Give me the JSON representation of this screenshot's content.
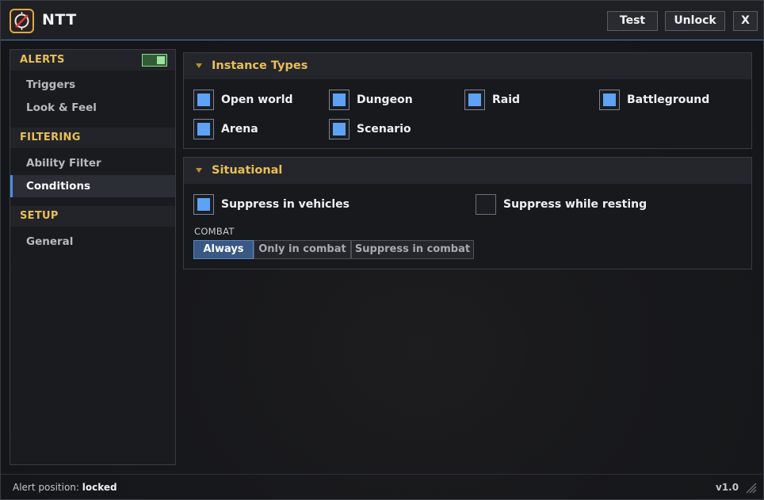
{
  "app": {
    "title": "NTT",
    "version": "v1.0",
    "colors": {
      "accent": "#5ea2f5",
      "section_header": "#e7bf57",
      "title_border": "#4e7fb8",
      "toggle_on": "#9de39e"
    }
  },
  "titlebar": {
    "logo_icon": "crossed-circle-logo",
    "buttons": {
      "test": "Test",
      "unlock": "Unlock",
      "close": "X"
    }
  },
  "sidebar": {
    "sections": [
      {
        "title": "ALERTS",
        "toggle_on": true,
        "items": [
          {
            "label": "Triggers",
            "active": false
          },
          {
            "label": "Look & Feel",
            "active": false
          }
        ]
      },
      {
        "title": "FILTERING",
        "items": [
          {
            "label": "Ability Filter",
            "active": false
          },
          {
            "label": "Conditions",
            "active": true
          }
        ]
      },
      {
        "title": "SETUP",
        "items": [
          {
            "label": "General",
            "active": false
          }
        ]
      }
    ]
  },
  "instance_types": {
    "title": "Instance Types",
    "options": [
      {
        "label": "Open world",
        "checked": true
      },
      {
        "label": "Dungeon",
        "checked": true
      },
      {
        "label": "Raid",
        "checked": true
      },
      {
        "label": "Battleground",
        "checked": true
      },
      {
        "label": "Arena",
        "checked": true
      },
      {
        "label": "Scenario",
        "checked": true
      }
    ]
  },
  "situational": {
    "title": "Situational",
    "options": [
      {
        "label": "Suppress in vehicles",
        "checked": true
      },
      {
        "label": "Suppress while resting",
        "checked": false
      }
    ],
    "combat_label": "COMBAT",
    "combat_modes": [
      {
        "label": "Always",
        "active": true
      },
      {
        "label": "Only in combat",
        "active": false
      },
      {
        "label": "Suppress in combat",
        "active": false
      }
    ]
  },
  "status": {
    "prefix": "Alert position:",
    "value": "locked"
  }
}
